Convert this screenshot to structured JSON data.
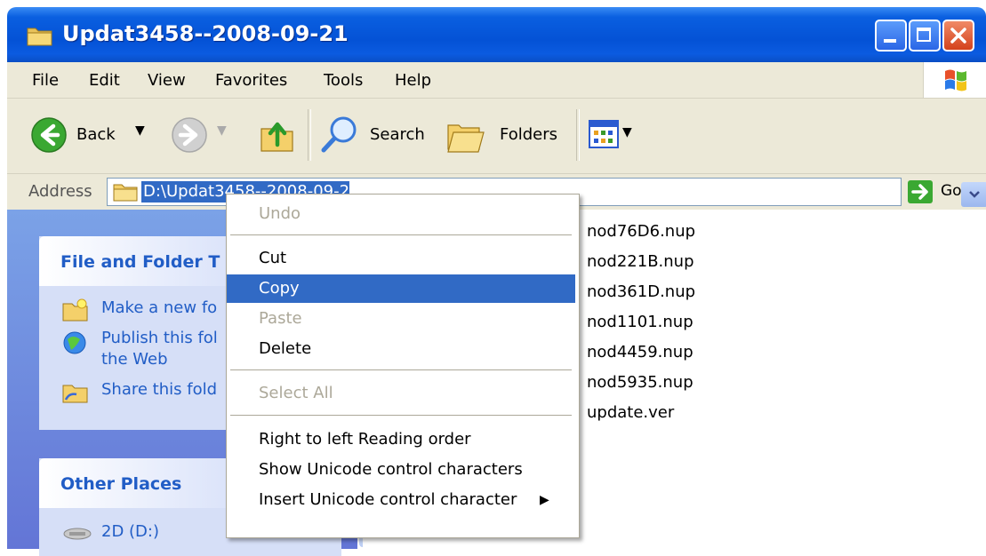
{
  "window": {
    "title": "Updat3458--2008-09-21"
  },
  "menubar": {
    "items": [
      "File",
      "Edit",
      "View",
      "Favorites",
      "Tools",
      "Help"
    ]
  },
  "toolbar": {
    "back_label": "Back",
    "search_label": "Search",
    "folders_label": "Folders"
  },
  "address": {
    "label": "Address",
    "value": "D:\\Updat3458--2008-09-21",
    "go_label": "Go"
  },
  "left_pane": {
    "file_folder_tasks": {
      "title": "File and Folder T",
      "tasks": [
        "Make a new fo",
        "Publish this fol",
        "the Web",
        "Share this fold"
      ]
    },
    "other_places": {
      "title": "Other Places",
      "items": [
        "2D (D:)"
      ]
    }
  },
  "files": [
    "nod76D6.nup",
    "nod221B.nup",
    "nod361D.nup",
    "nod1101.nup",
    "nod4459.nup",
    "nod5935.nup",
    "update.ver"
  ],
  "context_menu": {
    "undo": "Undo",
    "cut": "Cut",
    "copy": "Copy",
    "paste": "Paste",
    "delete": "Delete",
    "select_all": "Select All",
    "rtl": "Right to left Reading order",
    "show_unicode": "Show Unicode control characters",
    "insert_unicode": "Insert Unicode control character",
    "highlight_color": "#316ac5"
  }
}
